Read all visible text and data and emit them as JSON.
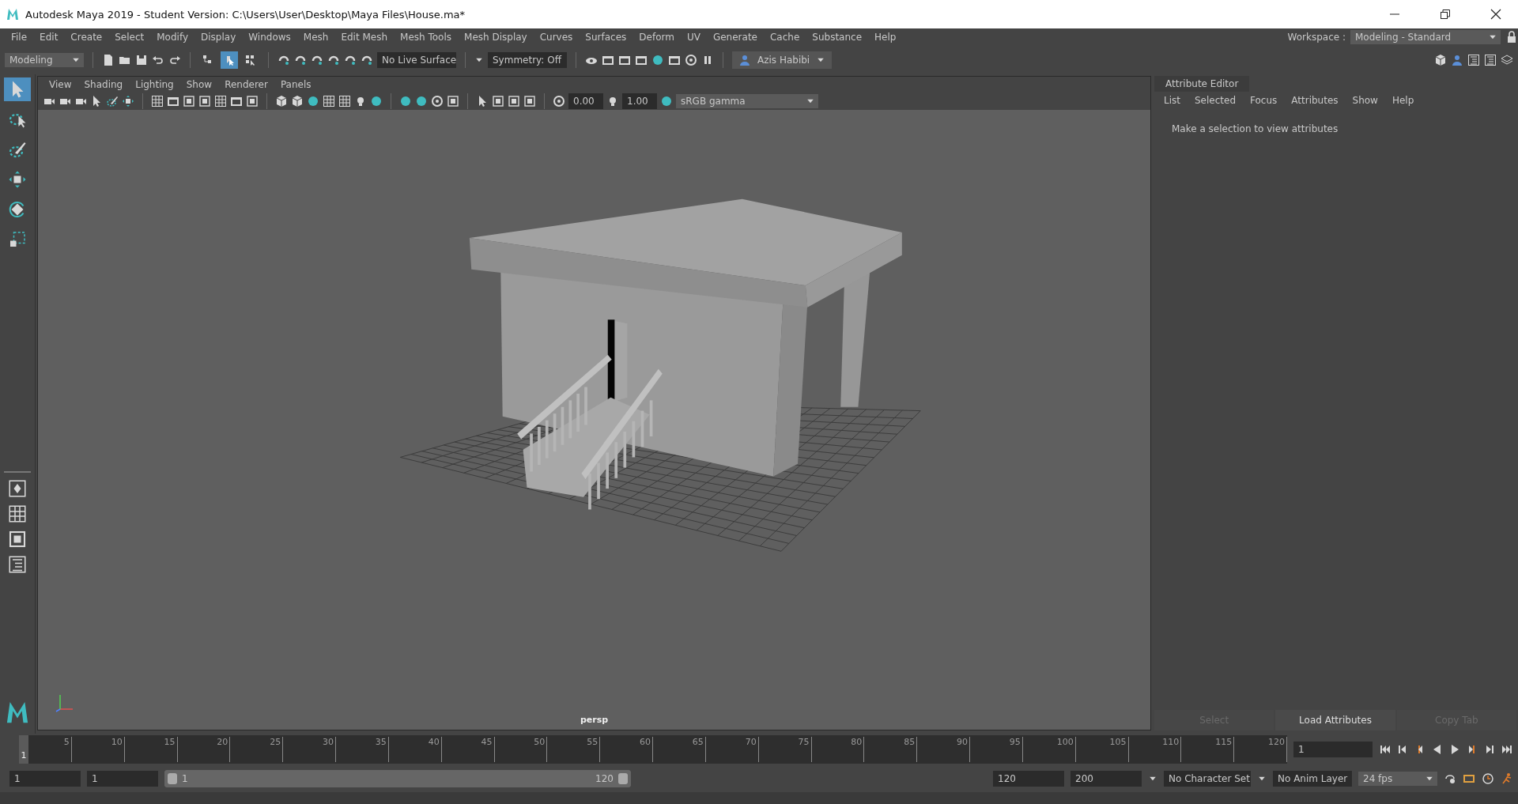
{
  "window": {
    "title": "Autodesk Maya 2019 - Student Version: C:\\Users\\User\\Desktop\\Maya Files\\House.ma*"
  },
  "menu": [
    "File",
    "Edit",
    "Create",
    "Select",
    "Modify",
    "Display",
    "Windows",
    "Mesh",
    "Edit Mesh",
    "Mesh Tools",
    "Mesh Display",
    "Curves",
    "Surfaces",
    "Deform",
    "UV",
    "Generate",
    "Cache",
    "Substance",
    "Help"
  ],
  "workspace": {
    "label": "Workspace :",
    "value": "Modeling - Standard"
  },
  "status_line": {
    "menu_set": "Modeling",
    "select_modes": [
      {
        "kind": "hierarchy",
        "selected": false
      },
      {
        "kind": "object",
        "selected": true
      },
      {
        "kind": "component",
        "selected": false
      }
    ],
    "live_surface": "No Live Surface",
    "symmetry": "Symmetry: Off",
    "user": "Azis Habibi"
  },
  "toolbox": [
    {
      "kind": "select",
      "selected": true
    },
    {
      "kind": "lasso",
      "selected": false
    },
    {
      "kind": "paint",
      "selected": false
    },
    {
      "kind": "move",
      "selected": false
    },
    {
      "kind": "rotate",
      "selected": false
    },
    {
      "kind": "scale",
      "selected": false
    }
  ],
  "viewport": {
    "menus": [
      "View",
      "Shading",
      "Lighting",
      "Show",
      "Renderer",
      "Panels"
    ],
    "exposure": "0.00",
    "gamma": "1.00",
    "color_space": "sRGB gamma",
    "camera": "persp"
  },
  "attribute_editor": {
    "title": "Attribute Editor",
    "menus": [
      "List",
      "Selected",
      "Focus",
      "Attributes",
      "Show",
      "Help"
    ],
    "message": "Make a selection to view attributes",
    "buttons": [
      {
        "label": "Select",
        "disabled": true
      },
      {
        "label": "Load Attributes",
        "disabled": false
      },
      {
        "label": "Copy Tab",
        "disabled": true
      }
    ]
  },
  "timeline": {
    "level": 0,
    "current_frame": "1",
    "ticks": [
      "5",
      "10",
      "15",
      "20",
      "25",
      "30",
      "35",
      "40",
      "45",
      "50",
      "55",
      "60",
      "65",
      "70",
      "75",
      "80",
      "85",
      "90",
      "95",
      "100",
      "105",
      "110",
      "115",
      "120"
    ],
    "frame_field": "1"
  },
  "range": {
    "level": 1,
    "start": "1",
    "range_start": "1",
    "slider_start": "1",
    "slider_end": "120",
    "range_end": "120",
    "end": "200",
    "character_set": "No Character Set",
    "anim_layer": "No Anim Layer",
    "fps": "24 fps"
  }
}
